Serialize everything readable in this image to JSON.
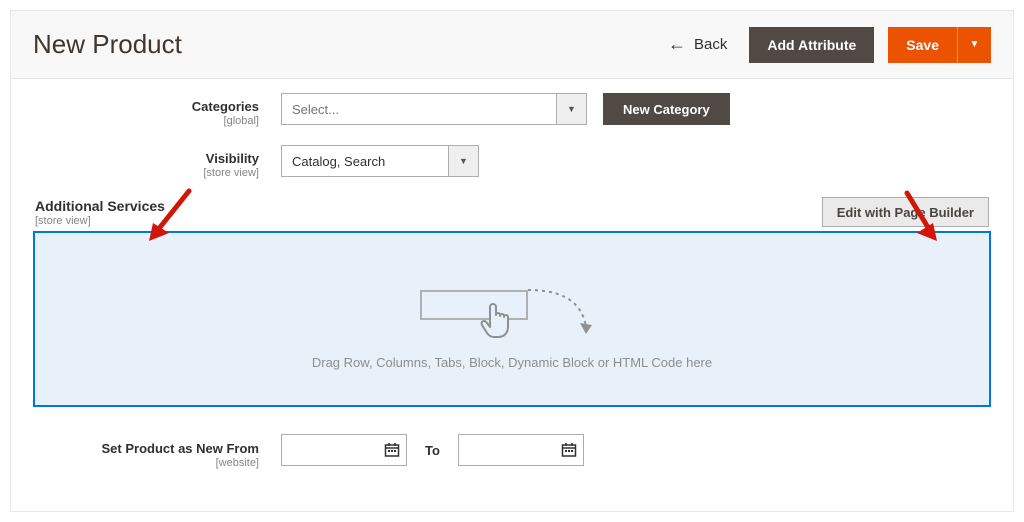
{
  "header": {
    "title": "New Product",
    "back_label": "Back",
    "add_attribute_label": "Add Attribute",
    "save_label": "Save"
  },
  "fields": {
    "categories": {
      "label": "Categories",
      "scope": "[global]",
      "placeholder": "Select...",
      "new_category_button": "New Category"
    },
    "visibility": {
      "label": "Visibility",
      "scope": "[store view]",
      "value": "Catalog, Search"
    },
    "additional_services": {
      "label": "Additional Services",
      "scope": "[store view]",
      "edit_button": "Edit with Page Builder",
      "drop_hint": "Drag Row, Columns, Tabs, Block, Dynamic Block or HTML Code here"
    },
    "set_new_from": {
      "label": "Set Product as New From",
      "scope": "[website]",
      "to_label": "To"
    }
  }
}
